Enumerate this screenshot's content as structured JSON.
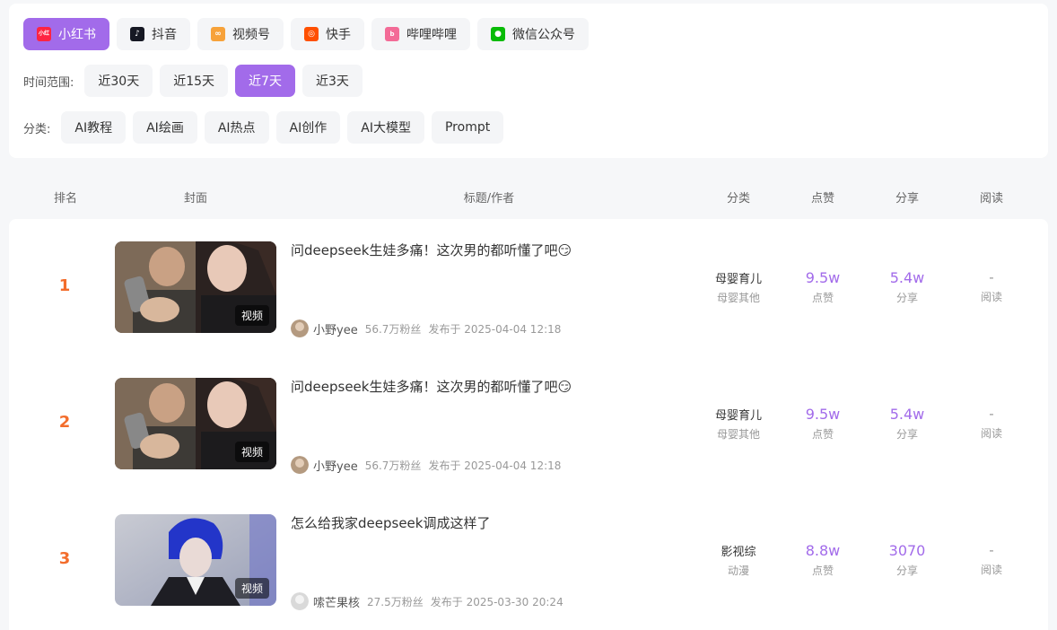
{
  "platforms": [
    {
      "label": "小红书",
      "icon": "xiaohongshu-icon",
      "color": "#ff2442",
      "active": true
    },
    {
      "label": "抖音",
      "icon": "douyin-icon",
      "color": "#161823",
      "active": false
    },
    {
      "label": "视频号",
      "icon": "shipinhao-icon",
      "color": "#f7a23a",
      "active": false
    },
    {
      "label": "快手",
      "icon": "kuaishou-icon",
      "color": "#ff5000",
      "active": false
    },
    {
      "label": "哔哩哔哩",
      "icon": "bilibili-icon",
      "color": "#f36b97",
      "active": false
    },
    {
      "label": "微信公众号",
      "icon": "wechat-icon",
      "color": "#09bb07",
      "active": false
    }
  ],
  "time_filter": {
    "label": "时间范围:",
    "options": [
      "近30天",
      "近15天",
      "近7天",
      "近3天"
    ],
    "selected": "近7天"
  },
  "category_filter": {
    "label": "分类:",
    "options": [
      "AI教程",
      "AI绘画",
      "AI热点",
      "AI创作",
      "AI大模型",
      "Prompt"
    ]
  },
  "table": {
    "headers": {
      "rank": "排名",
      "cover": "封面",
      "title_author": "标题/作者",
      "category": "分类",
      "likes": "点赞",
      "shares": "分享",
      "reads": "阅读"
    },
    "rows": [
      {
        "rank": "1",
        "cover_tag": "视频",
        "title": "问deepseek生娃多痛！这次男的都听懂了吧😏",
        "author": "小野yee",
        "fans": "56.7万粉丝",
        "published": "发布于 2025-04-04 12:18",
        "category": "母婴育儿",
        "subcategory": "母婴其他",
        "likes": "9.5w",
        "likes_label": "点赞",
        "shares": "5.4w",
        "shares_label": "分享",
        "reads": "-",
        "reads_label": "阅读"
      },
      {
        "rank": "2",
        "cover_tag": "视频",
        "title": "问deepseek生娃多痛！这次男的都听懂了吧😏",
        "author": "小野yee",
        "fans": "56.7万粉丝",
        "published": "发布于 2025-04-04 12:18",
        "category": "母婴育儿",
        "subcategory": "母婴其他",
        "likes": "9.5w",
        "likes_label": "点赞",
        "shares": "5.4w",
        "shares_label": "分享",
        "reads": "-",
        "reads_label": "阅读"
      },
      {
        "rank": "3",
        "cover_tag": "视频",
        "title": "怎么给我家deepseek调成这样了",
        "author": "嗦芒果核",
        "fans": "27.5万粉丝",
        "published": "发布于 2025-03-30 20:24",
        "category": "影视综",
        "subcategory": "动漫",
        "likes": "8.8w",
        "likes_label": "点赞",
        "shares": "3070",
        "shares_label": "分享",
        "reads": "-",
        "reads_label": "阅读"
      }
    ]
  }
}
